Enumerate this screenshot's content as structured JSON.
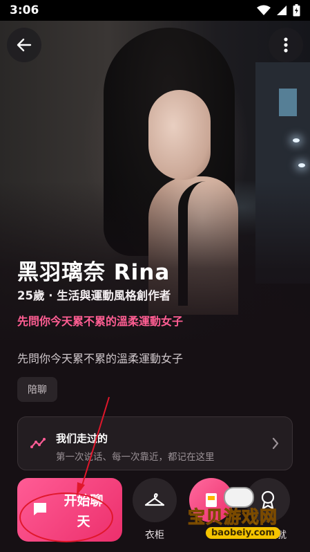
{
  "status_bar": {
    "time": "3:06"
  },
  "profile": {
    "name": "黑羽璃奈 Rina",
    "subtitle": "25歲 · 生活與運動風格創作者",
    "tagline": "先問你今天累不累的溫柔運動女子",
    "description": "先問你今天累不累的溫柔運動女子",
    "tag": "陪聊"
  },
  "memory_card": {
    "title": "我们走过的",
    "subtitle": "第一次说话、每一次靠近，都记在这里"
  },
  "actions": {
    "start_chat": "开始聊天",
    "wardrobe": "衣柜",
    "achievements": "成就"
  },
  "watermark": {
    "text": "宝贝游戏网",
    "url": "baobeiy.com"
  },
  "colors": {
    "accent": "#ff5c95",
    "tagline": "#ff5e93",
    "background": "#161014",
    "annotation": "#e0172b"
  }
}
